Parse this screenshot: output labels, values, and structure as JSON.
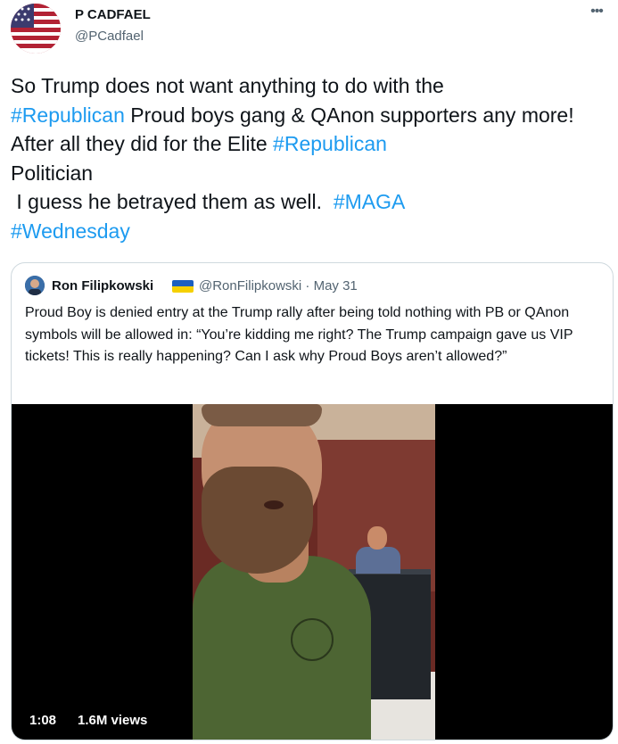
{
  "tweet": {
    "author_name": "P CADFAEL",
    "author_handle": "@PCadfael",
    "more_icon": "more-horizontal-icon",
    "text_parts": [
      {
        "t": "So Trump does not want anything to do with the\n"
      },
      {
        "t": "#Republican",
        "tag": true
      },
      {
        "t": " Proud boys gang & QAnon supporters any more!  After all they did for the Elite "
      },
      {
        "t": "#Republican",
        "tag": true
      },
      {
        "t": "\nPolitician\n I guess he betrayed them as well.  "
      },
      {
        "t": "#MAGA",
        "tag": true
      },
      {
        "t": "\n"
      },
      {
        "t": "#Wednesday",
        "tag": true
      }
    ]
  },
  "quote": {
    "author_name": "Ron Filipkowski",
    "flag_icon": "ukraine-flag-icon",
    "handle_date": "@RonFilipkowski · May 31",
    "text": "Proud Boy is denied entry at the Trump rally after being told nothing with PB or QAnon symbols will be allowed in: “You’re kidding me right? The Trump campaign gave us VIP tickets! This is really happening? Can I ask why Proud Boys aren’t allowed?”",
    "video": {
      "duration": "1:08",
      "views": "1.6M views"
    }
  },
  "colors": {
    "hashtag": "#1d9bf0",
    "secondary_text": "#536471",
    "border": "#cfd9de"
  }
}
